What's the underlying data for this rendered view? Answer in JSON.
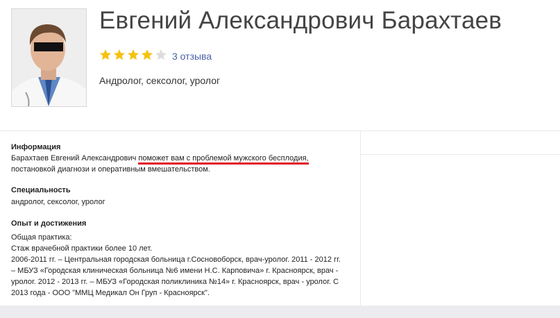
{
  "doctor": {
    "name": "Евгений Александрович Барахтаев",
    "rating": 4,
    "rating_max": 5,
    "reviews_label": "3 отзыва",
    "specialties": "Андролог, сексолог, уролог"
  },
  "info": {
    "title": "Информация",
    "text_part1": "Барахтаев Евгений Александрович ",
    "text_highlight": "поможет вам с проблемой мужского бесплодия,",
    "text_part2": "постановкой диагнози и оперативным вмешательством."
  },
  "specialty": {
    "title": "Специальность",
    "text": "андролог, сексолог, уролог"
  },
  "experience": {
    "title": "Опыт и достижения",
    "lines": [
      "Общая практика:",
      "Стаж врачебной практики более 10 лет.",
      "2006-2011 гг. – Центральная городская больница г.Сосновоборск, врач-уролог. 2011 - 2012 гг.",
      "– МБУЗ «Городская клиническая больница №6 имени Н.С. Карповича» г. Красноярск, врач -",
      "уролог. 2012 - 2013 гг. – МБУЗ «Городская поликлиника №14» г. Красноярск, врач - уролог. С",
      "2013 года - ООО \"ММЦ Медикал Он Груп - Красноярск\"."
    ]
  },
  "colors": {
    "star_filled": "#f5c211",
    "star_empty": "#dcdcdc",
    "link": "#4a61a8",
    "highlight_underline": "#e0152a"
  }
}
